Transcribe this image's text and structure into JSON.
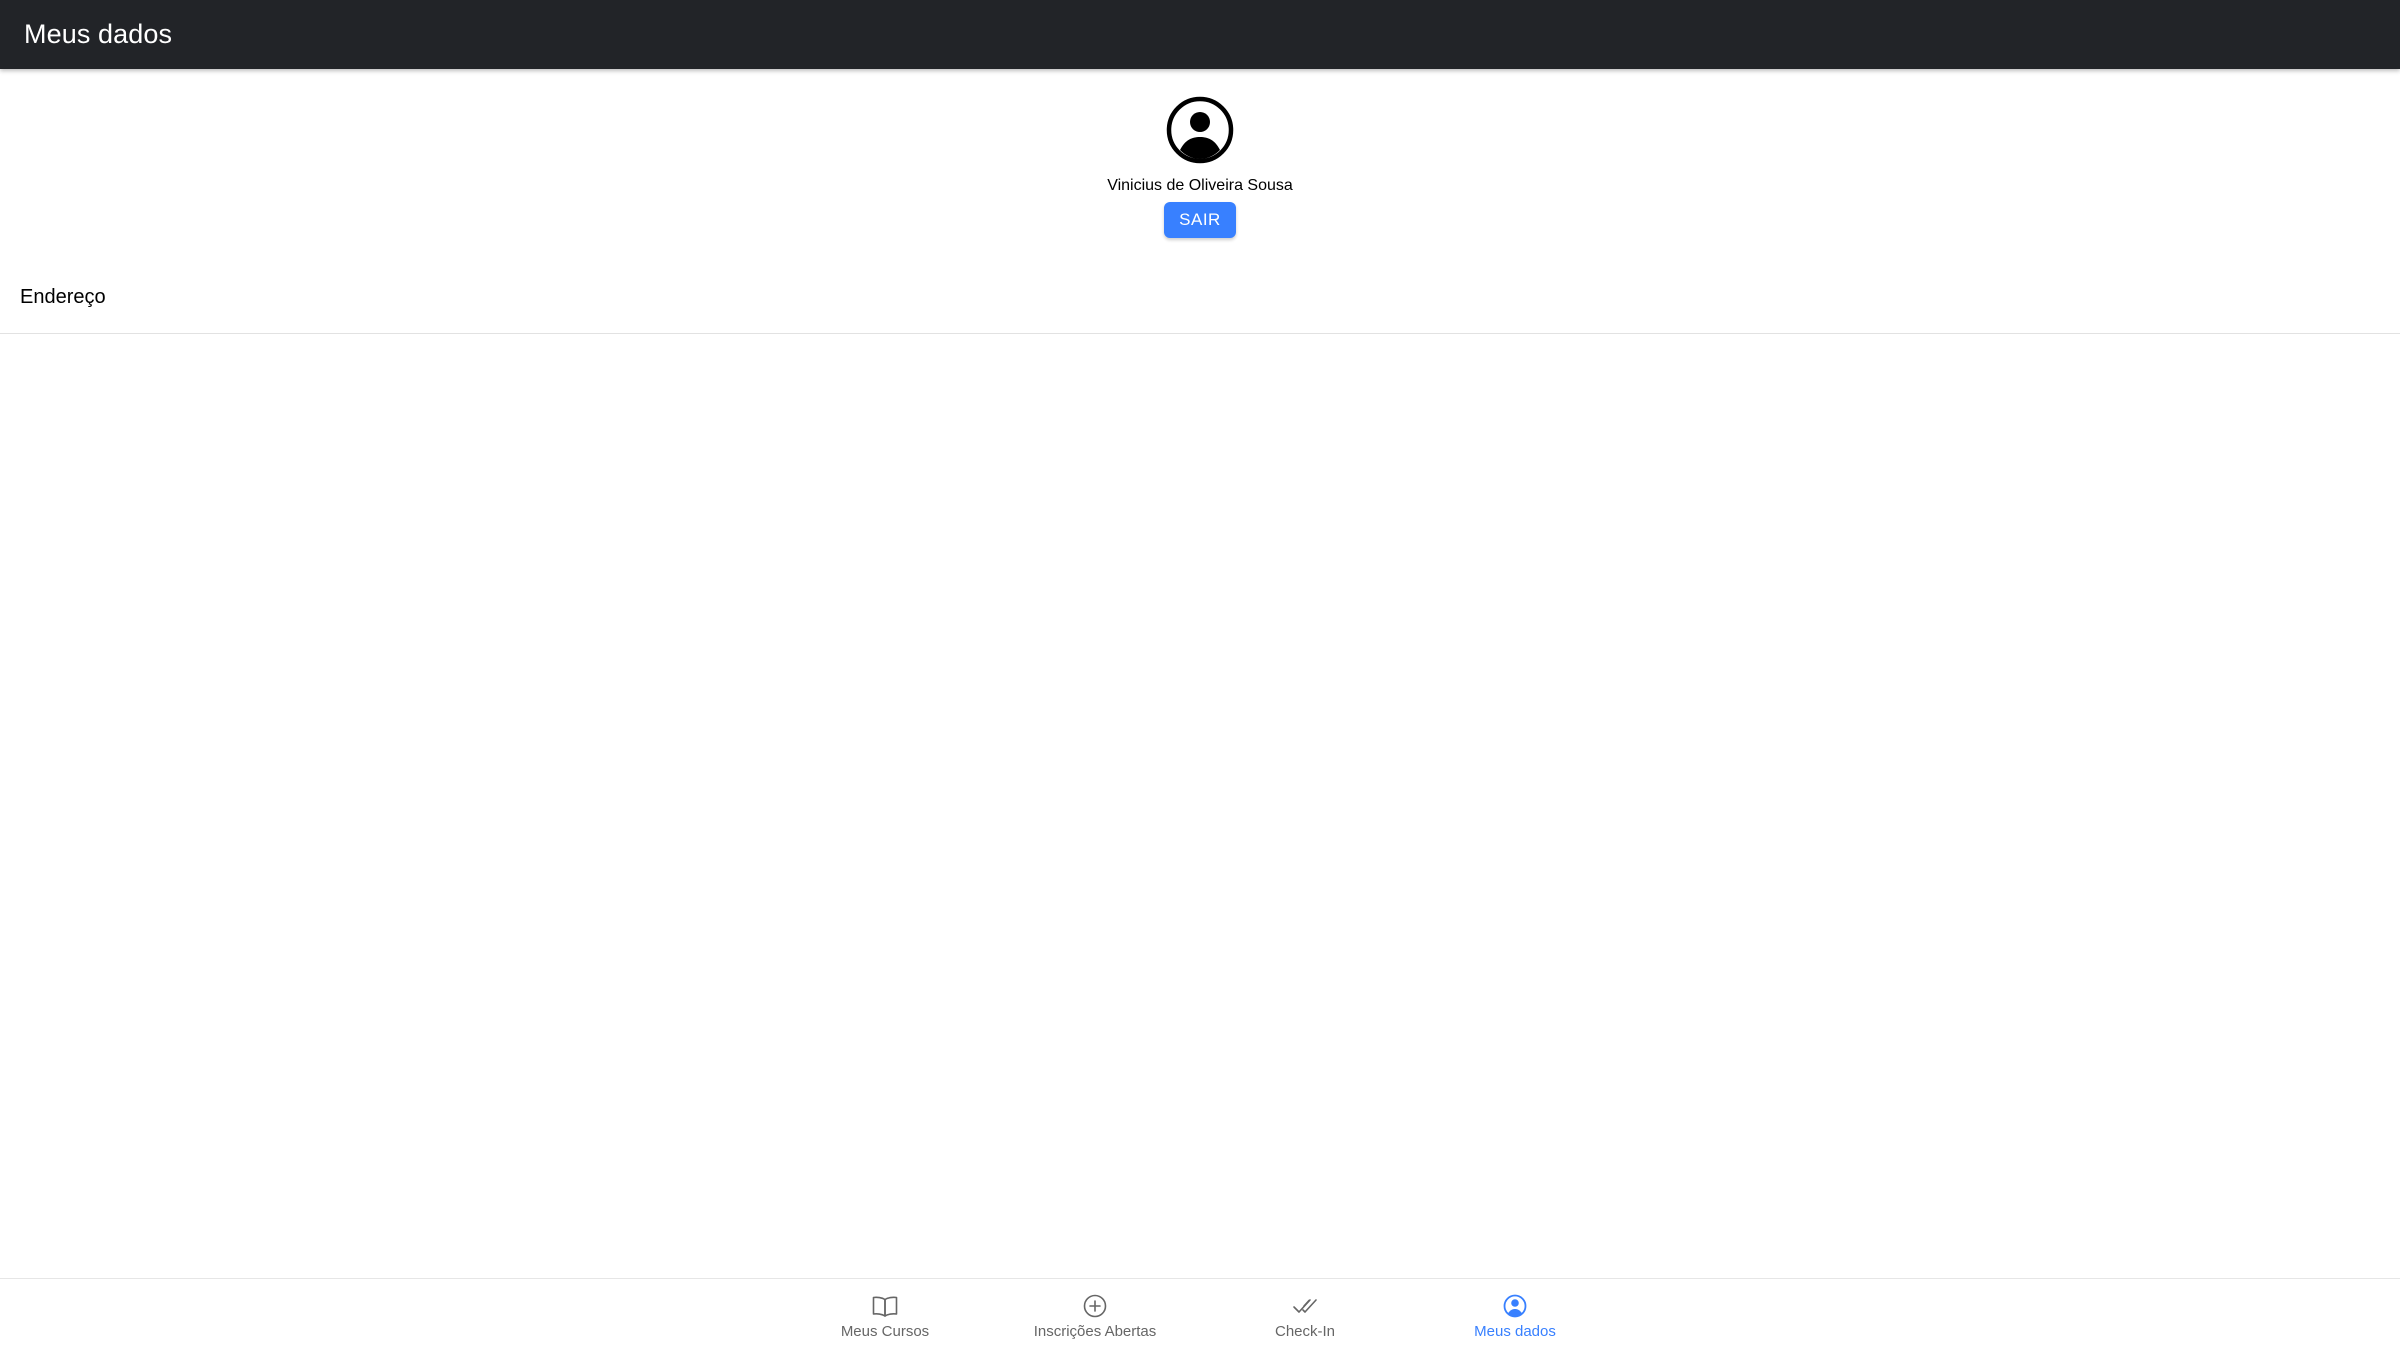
{
  "header": {
    "title": "Meus dados"
  },
  "profile": {
    "avatar_icon": "person-circle-icon",
    "name": "Vinicius de Oliveira Sousa",
    "logout_label": "SAIR"
  },
  "address": {
    "label": "Endereço"
  },
  "tabbar": {
    "active_color": "#3880ff",
    "inactive_color": "#666666",
    "tabs": [
      {
        "label": "Meus Cursos",
        "icon": "book-icon",
        "active": false
      },
      {
        "label": "Inscrições Abertas",
        "icon": "add-circle-icon",
        "active": false
      },
      {
        "label": "Check-In",
        "icon": "checkmark-done-icon",
        "active": false
      },
      {
        "label": "Meus dados",
        "icon": "person-circle-icon",
        "active": true
      }
    ]
  },
  "colors": {
    "toolbar": "#222428",
    "primary": "#3880ff"
  }
}
